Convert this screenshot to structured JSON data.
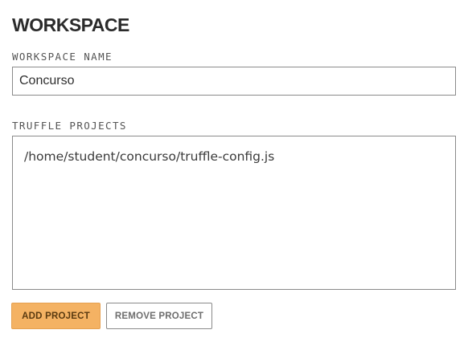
{
  "workspace": {
    "heading": "WORKSPACE",
    "name_label": "WORKSPACE NAME",
    "name_value": "Concurso",
    "projects_label": "TRUFFLE PROJECTS",
    "projects": [
      "/home/student/concurso/truffle-config.js"
    ]
  },
  "actions": {
    "add_label": "ADD PROJECT",
    "remove_label": "REMOVE PROJECT"
  },
  "colors": {
    "accent": "#f4b263",
    "border": "#8a8a8a",
    "text": "#3c3c3c"
  }
}
